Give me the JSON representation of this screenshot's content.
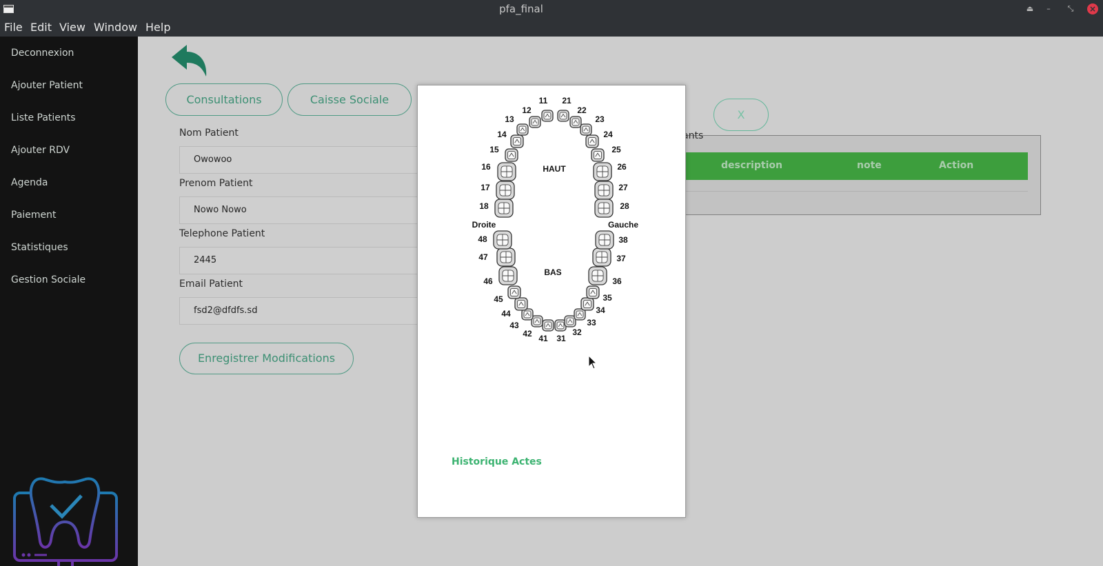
{
  "window": {
    "title": "pfa_final"
  },
  "menubar": [
    "File",
    "Edit",
    "View",
    "Window",
    "Help"
  ],
  "sidebar": {
    "items": [
      "Deconnexion",
      "Ajouter Patient",
      "Liste Patients",
      "Ajouter RDV",
      "Agenda",
      "Paiement",
      "Statistiques",
      "Gestion Sociale"
    ]
  },
  "tabs": [
    "Consultations",
    "Caisse Sociale"
  ],
  "form": {
    "nom_label": "Nom Patient",
    "nom_value": "Owowoo",
    "prenom_label": "Prenom Patient",
    "prenom_value": "Nowo Nowo",
    "tel_label": "Telephone Patient",
    "tel_value": "2445",
    "email_label": "Email Patient",
    "email_value": "fsd2@dfdfs.sd",
    "save_label": "Enregistrer Modifications"
  },
  "close_label": "X",
  "panel": {
    "label_fragment": "ants",
    "columns": [
      "description",
      "note",
      "Action"
    ]
  },
  "modal": {
    "chart": {
      "upper_label": "HAUT",
      "lower_label": "BAS",
      "right_label": "Droite",
      "left_label": "Gauche",
      "upper_right": [
        "18",
        "17",
        "16",
        "15",
        "14",
        "13",
        "12",
        "11"
      ],
      "upper_left": [
        "21",
        "22",
        "23",
        "24",
        "25",
        "26",
        "27",
        "28"
      ],
      "lower_left": [
        "31",
        "32",
        "33",
        "34",
        "35",
        "36",
        "37",
        "38"
      ],
      "lower_right": [
        "41",
        "42",
        "43",
        "44",
        "45",
        "46",
        "47",
        "48"
      ]
    },
    "history_link": "Historique Actes"
  },
  "colors": {
    "accent": "#3c8f73",
    "table_header": "#3d9e3d",
    "link": "#3cb371",
    "sidebar_bg": "#131313",
    "logo_top": "#1e7ab0",
    "logo_bottom": "#6a35a8"
  }
}
